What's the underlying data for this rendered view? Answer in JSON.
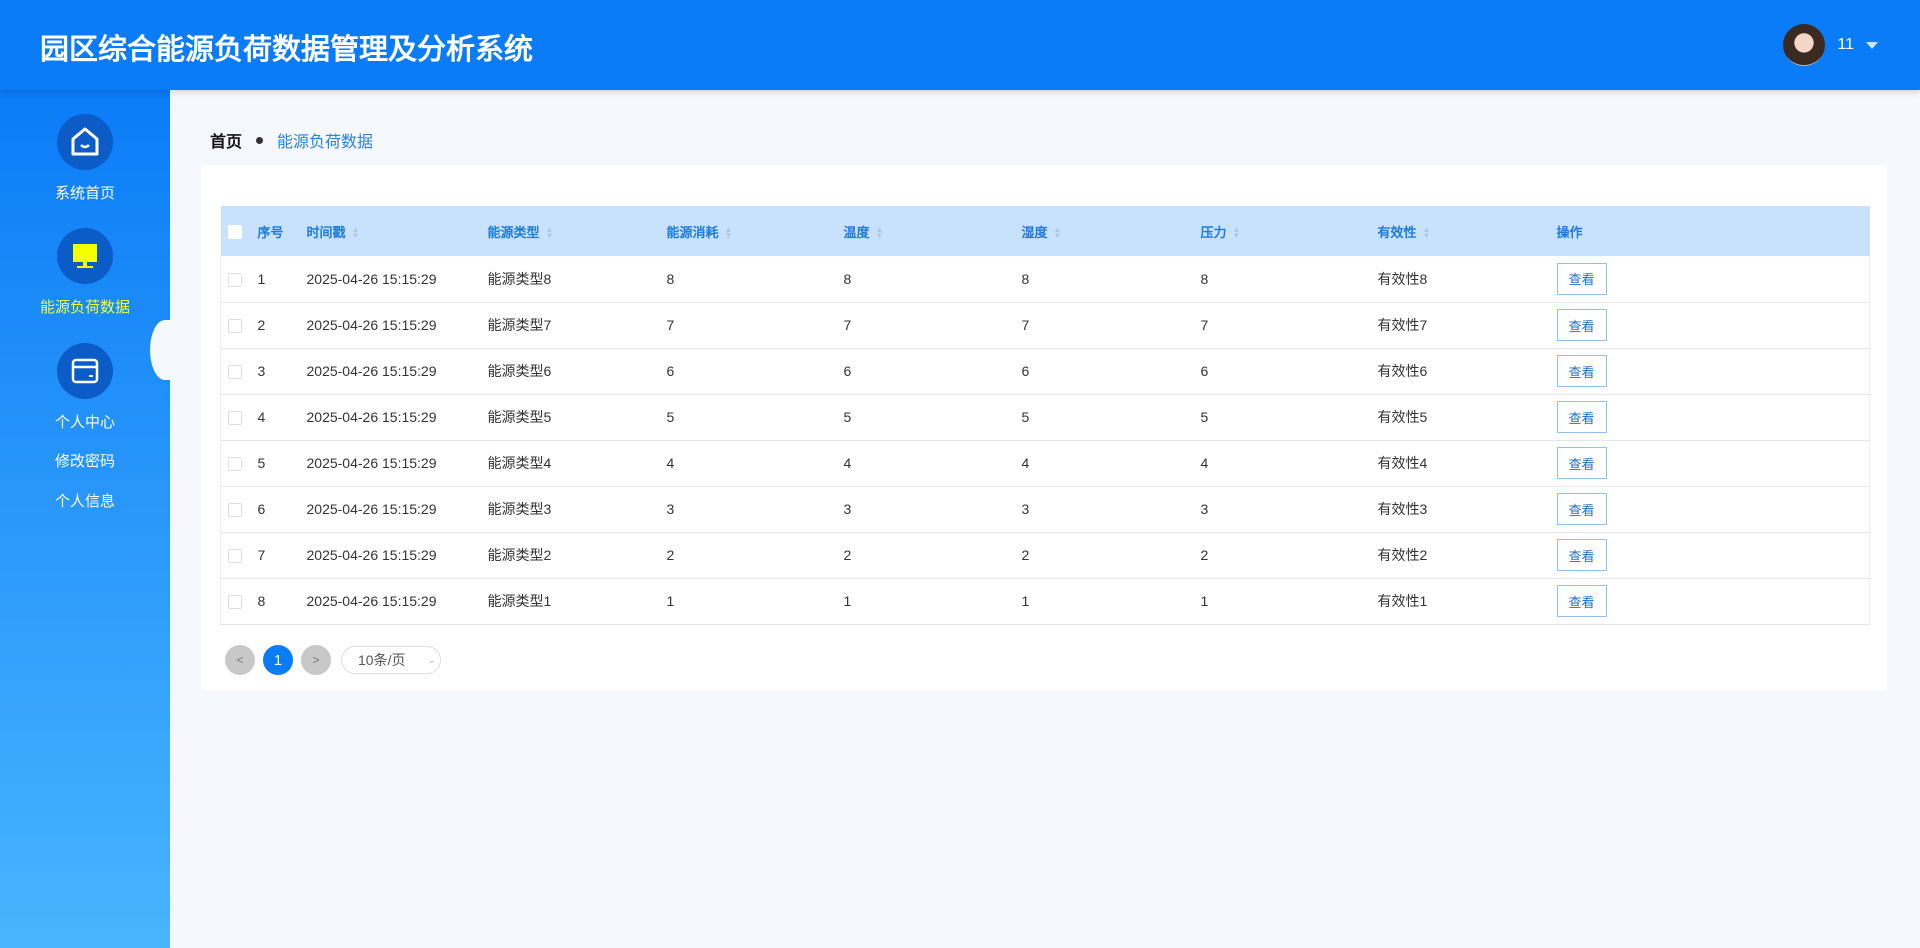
{
  "header": {
    "title": "园区综合能源负荷数据管理及分析系统",
    "username": "11"
  },
  "sidebar": {
    "items": [
      {
        "label": "系统首页"
      },
      {
        "label": "能源负荷数据"
      },
      {
        "label": "个人中心"
      }
    ],
    "subitems": [
      {
        "label": "修改密码"
      },
      {
        "label": "个人信息"
      }
    ]
  },
  "breadcrumb": {
    "home": "首页",
    "current": "能源负荷数据"
  },
  "table": {
    "columns": [
      "序号",
      "时间戳",
      "能源类型",
      "能源消耗",
      "温度",
      "湿度",
      "压力",
      "有效性",
      "操作"
    ],
    "rows": [
      [
        "1",
        "2025-04-26 15:15:29",
        "能源类型8",
        "8",
        "8",
        "8",
        "8",
        "有效性8"
      ],
      [
        "2",
        "2025-04-26 15:15:29",
        "能源类型7",
        "7",
        "7",
        "7",
        "7",
        "有效性7"
      ],
      [
        "3",
        "2025-04-26 15:15:29",
        "能源类型6",
        "6",
        "6",
        "6",
        "6",
        "有效性6"
      ],
      [
        "4",
        "2025-04-26 15:15:29",
        "能源类型5",
        "5",
        "5",
        "5",
        "5",
        "有效性5"
      ],
      [
        "5",
        "2025-04-26 15:15:29",
        "能源类型4",
        "4",
        "4",
        "4",
        "4",
        "有效性4"
      ],
      [
        "6",
        "2025-04-26 15:15:29",
        "能源类型3",
        "3",
        "3",
        "3",
        "3",
        "有效性3"
      ],
      [
        "7",
        "2025-04-26 15:15:29",
        "能源类型2",
        "2",
        "2",
        "2",
        "2",
        "有效性2"
      ],
      [
        "8",
        "2025-04-26 15:15:29",
        "能源类型1",
        "1",
        "1",
        "1",
        "1",
        "有效性1"
      ]
    ],
    "view_label": "查看"
  },
  "pagination": {
    "prev": "<",
    "current": "1",
    "next": ">",
    "page_size": "10条/页"
  }
}
